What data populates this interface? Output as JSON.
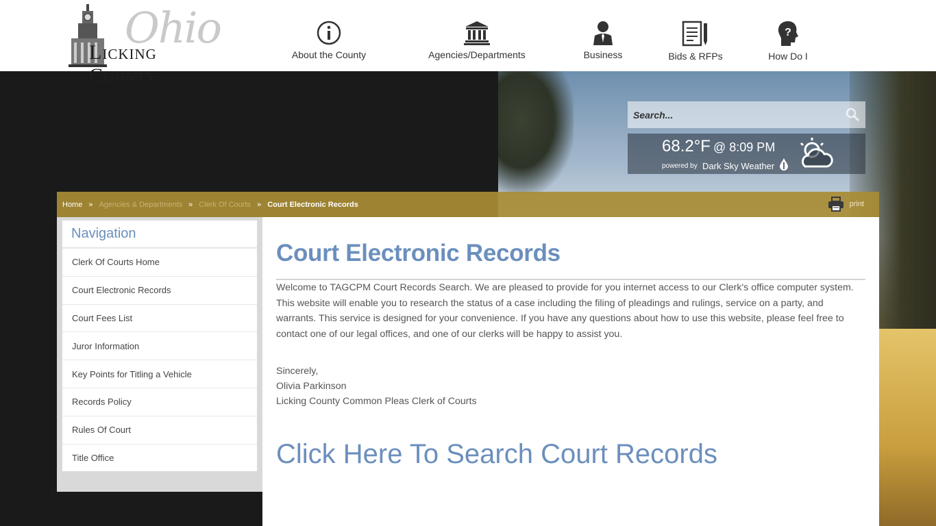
{
  "header": {
    "logo_script": "Ohio",
    "logo_text": "Licking County",
    "nav": [
      {
        "label": "About the County",
        "icon": "info-icon"
      },
      {
        "label": "Agencies/Departments",
        "icon": "building-icon"
      },
      {
        "label": "Business",
        "icon": "businessman-icon"
      },
      {
        "label": "Bids & RFPs",
        "icon": "document-pen-icon"
      },
      {
        "label": "How Do I",
        "icon": "question-head-icon"
      }
    ]
  },
  "search": {
    "placeholder": "Search..."
  },
  "weather": {
    "temp": "68.2°F",
    "time": "@ 8:09 PM",
    "powered_by": "powered by",
    "provider": "Dark Sky Weather"
  },
  "breadcrumb": {
    "items": [
      "Home",
      "Agencies & Departments",
      "Clerk Of Courts",
      "Court Electronic Records"
    ],
    "separator": "»"
  },
  "print": {
    "label": "print"
  },
  "sidebar": {
    "title": "Navigation",
    "items": [
      "Clerk Of Courts Home",
      "Court Electronic Records",
      "Court Fees List",
      "Juror Information",
      "Key Points for Titling a Vehicle",
      "Records Policy",
      "Rules Of Court",
      "Title Office"
    ]
  },
  "main": {
    "title": "Court Electronic Records",
    "paragraph": "Welcome to TAGCPM Court Records Search. We are pleased to provide for you internet access to our Clerk's office computer system. This website will enable you to research the status of a case including the filing of pleadings and rulings, service on a party, and warrants. This service is designed for your convenience. If you have any questions about how to use this website, please feel free to contact one of our legal offices, and one of our clerks will be happy to assist you.",
    "signature": [
      "Sincerely,",
      "Olivia Parkinson",
      "Licking County Common Pleas Clerk of Courts"
    ],
    "cta": "Click Here To Search Court Records"
  },
  "colors": {
    "accent_blue": "#6b8fbd",
    "breadcrumb_gold": "#a88c34",
    "dark_bg": "#1a1a1a"
  }
}
